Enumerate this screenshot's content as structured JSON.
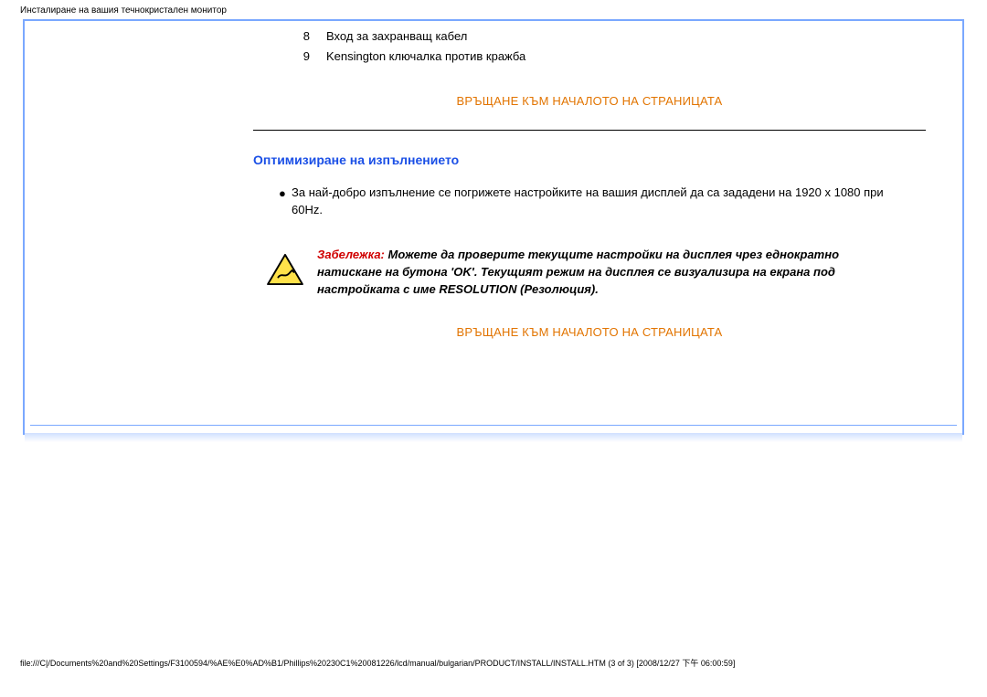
{
  "page_title": "Инсталиране на вашия течнокристален монитор",
  "list": {
    "items": [
      {
        "n": "8",
        "t": "Вход за захранващ кабел"
      },
      {
        "n": "9",
        "t": "Kensington ключалка против кражба"
      }
    ]
  },
  "back_to_top": "ВРЪЩАНЕ КЪМ НАЧАЛОТО НА СТРАНИЦАТА",
  "section_title": "Оптимизиране на изпълнението",
  "bullet": "За най-добро изпълнение се погрижете настройките на вашия дисплей да са зададени на 1920 x 1080 при 60Hz.",
  "note": {
    "label": "Забележка:",
    "body": " Можете да проверите текущите настройки на дисплея чрез еднократно натискане на бутона 'OK'. Текущият режим на дисплея се визуализира на екрана под настройката с име RESOLUTION (Резолюция)."
  },
  "footer": "file:///C|/Documents%20and%20Settings/F3100594/%AE%E0%AD%B1/Phillips%20230C1%20081226/lcd/manual/bulgarian/PRODUCT/INSTALL/INSTALL.HTM (3 of 3) [2008/12/27 下午 06:00:59]"
}
